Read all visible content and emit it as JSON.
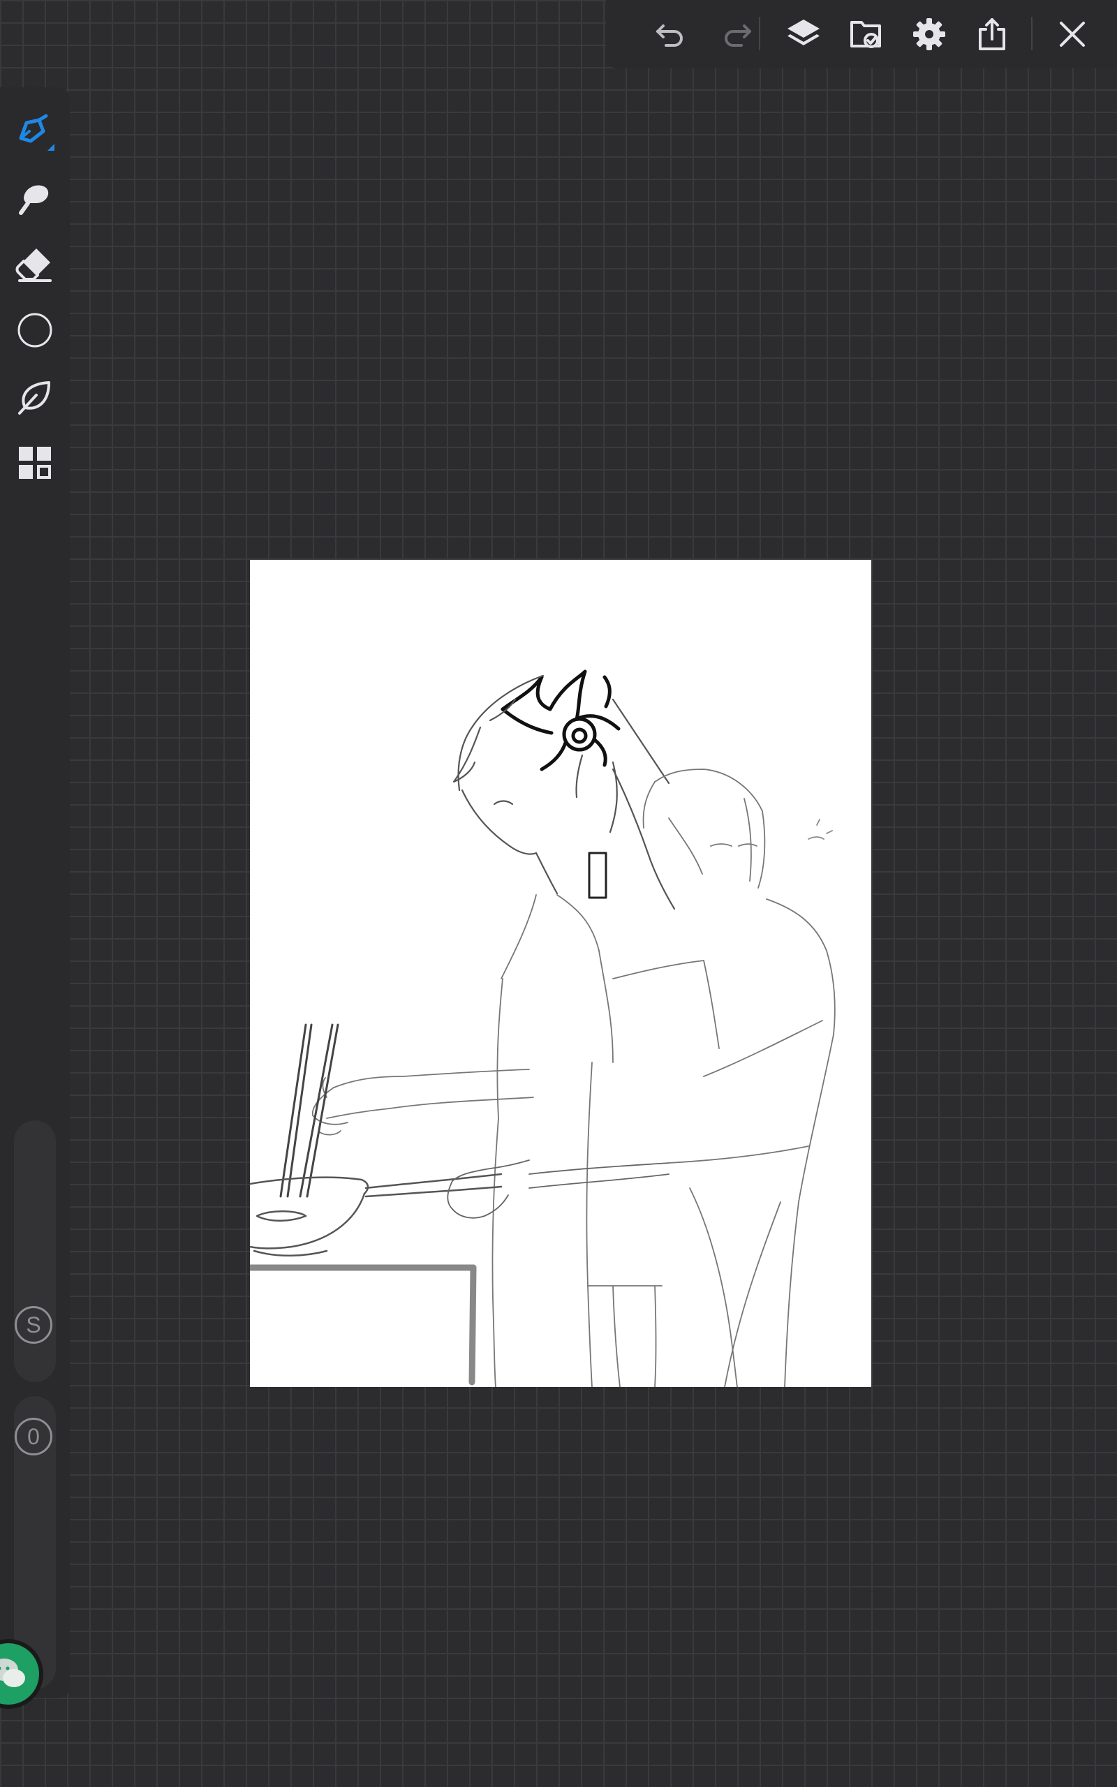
{
  "toolbar": {
    "buttons": [
      "undo-icon",
      "redo-icon",
      "layers-icon",
      "import-image-icon",
      "settings-icon",
      "share-icon",
      "close-icon"
    ]
  },
  "tools": {
    "items": [
      "pen-icon",
      "smudge-icon",
      "eraser-icon",
      "color-icon",
      "leaf-icon",
      "grid-icon"
    ],
    "active_color": "#1e88e5"
  },
  "brush_size": {
    "label": "S",
    "value": 0.92
  },
  "opacity": {
    "label": "0"
  },
  "canvas": {
    "background": "#ffffff"
  },
  "chat": {
    "icon": "wechat-icon",
    "color": "#1e9f63"
  }
}
